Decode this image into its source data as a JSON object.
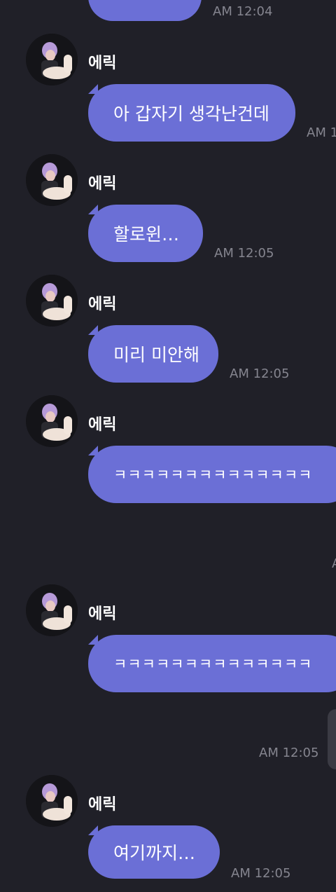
{
  "sender_name": "에릭",
  "messages": [
    {
      "text": "",
      "time": "AM 12:04"
    },
    {
      "text": "아 갑자기 생각난건데",
      "time": "AM 1"
    },
    {
      "text": "할로윈…",
      "time": "AM 12:05"
    },
    {
      "text": "미리 미안해",
      "time": "AM 12:05"
    },
    {
      "text": "ㅋㅋㅋㅋㅋㅋㅋㅋㅋㅋㅋㅋㅋㅋ",
      "time": ""
    },
    {
      "text": "ㅋㅋㅋㅋㅋㅋㅋㅋㅋㅋㅋㅋㅋㅋ",
      "time": ""
    },
    {
      "text": "여기까지…",
      "time": "AM 12:05"
    }
  ],
  "my_message_time": "AM 12:05",
  "colors": {
    "background": "#202028",
    "bubble": "#6b6fd6",
    "time_text": "#85858f"
  }
}
